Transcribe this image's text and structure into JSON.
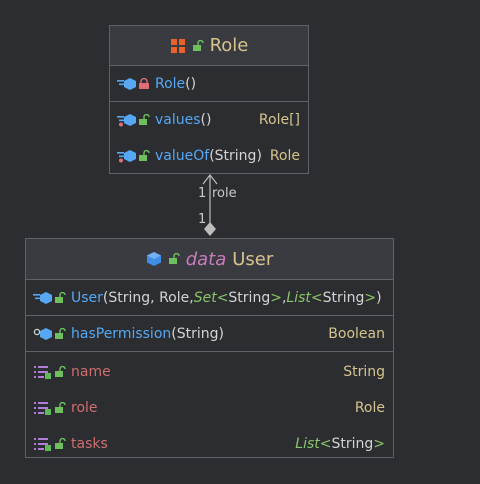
{
  "role_class": {
    "name": "Role",
    "header_icon": "enum-icon",
    "constructors": [
      {
        "name": "Role",
        "params": "()"
      }
    ],
    "methods": [
      {
        "name": "values",
        "params": "()",
        "return_type": "Role[]"
      },
      {
        "name": "valueOf",
        "params": "(String)",
        "return_type": "Role"
      }
    ]
  },
  "association": {
    "label": "role",
    "multiplicity_top": "1",
    "multiplicity_bottom": "1"
  },
  "user_class": {
    "keyword": "data",
    "name": "User",
    "header_icon": "class-icon",
    "constructor": {
      "name": "User",
      "p1": "(String, Role, ",
      "p_generic1": "Set",
      "p_lt1": "<",
      "p_inner1": "String",
      "p_gt1": ">",
      "p_sep": ", ",
      "p_generic2": "List",
      "p_lt2": "<",
      "p_inner2": "String",
      "p_gt2": ">",
      "p_end": ")"
    },
    "methods": [
      {
        "name": "hasPermission",
        "params": "(String)",
        "return_type": "Boolean"
      }
    ],
    "fields": [
      {
        "name": "name",
        "type": "String"
      },
      {
        "name": "role",
        "type": "Role"
      },
      {
        "name": "tasks",
        "type_generic": "List",
        "type_lt": "<",
        "type_inner": "String",
        "type_gt": ">"
      }
    ]
  },
  "colors": {
    "background": "#2b2d30",
    "header": "#393b40",
    "border": "#5f6166",
    "method": "#56a8f5",
    "field": "#cf6e6e",
    "type": "#d6c38e",
    "keyword": "#c77dbb",
    "generic": "#8bc56a"
  }
}
